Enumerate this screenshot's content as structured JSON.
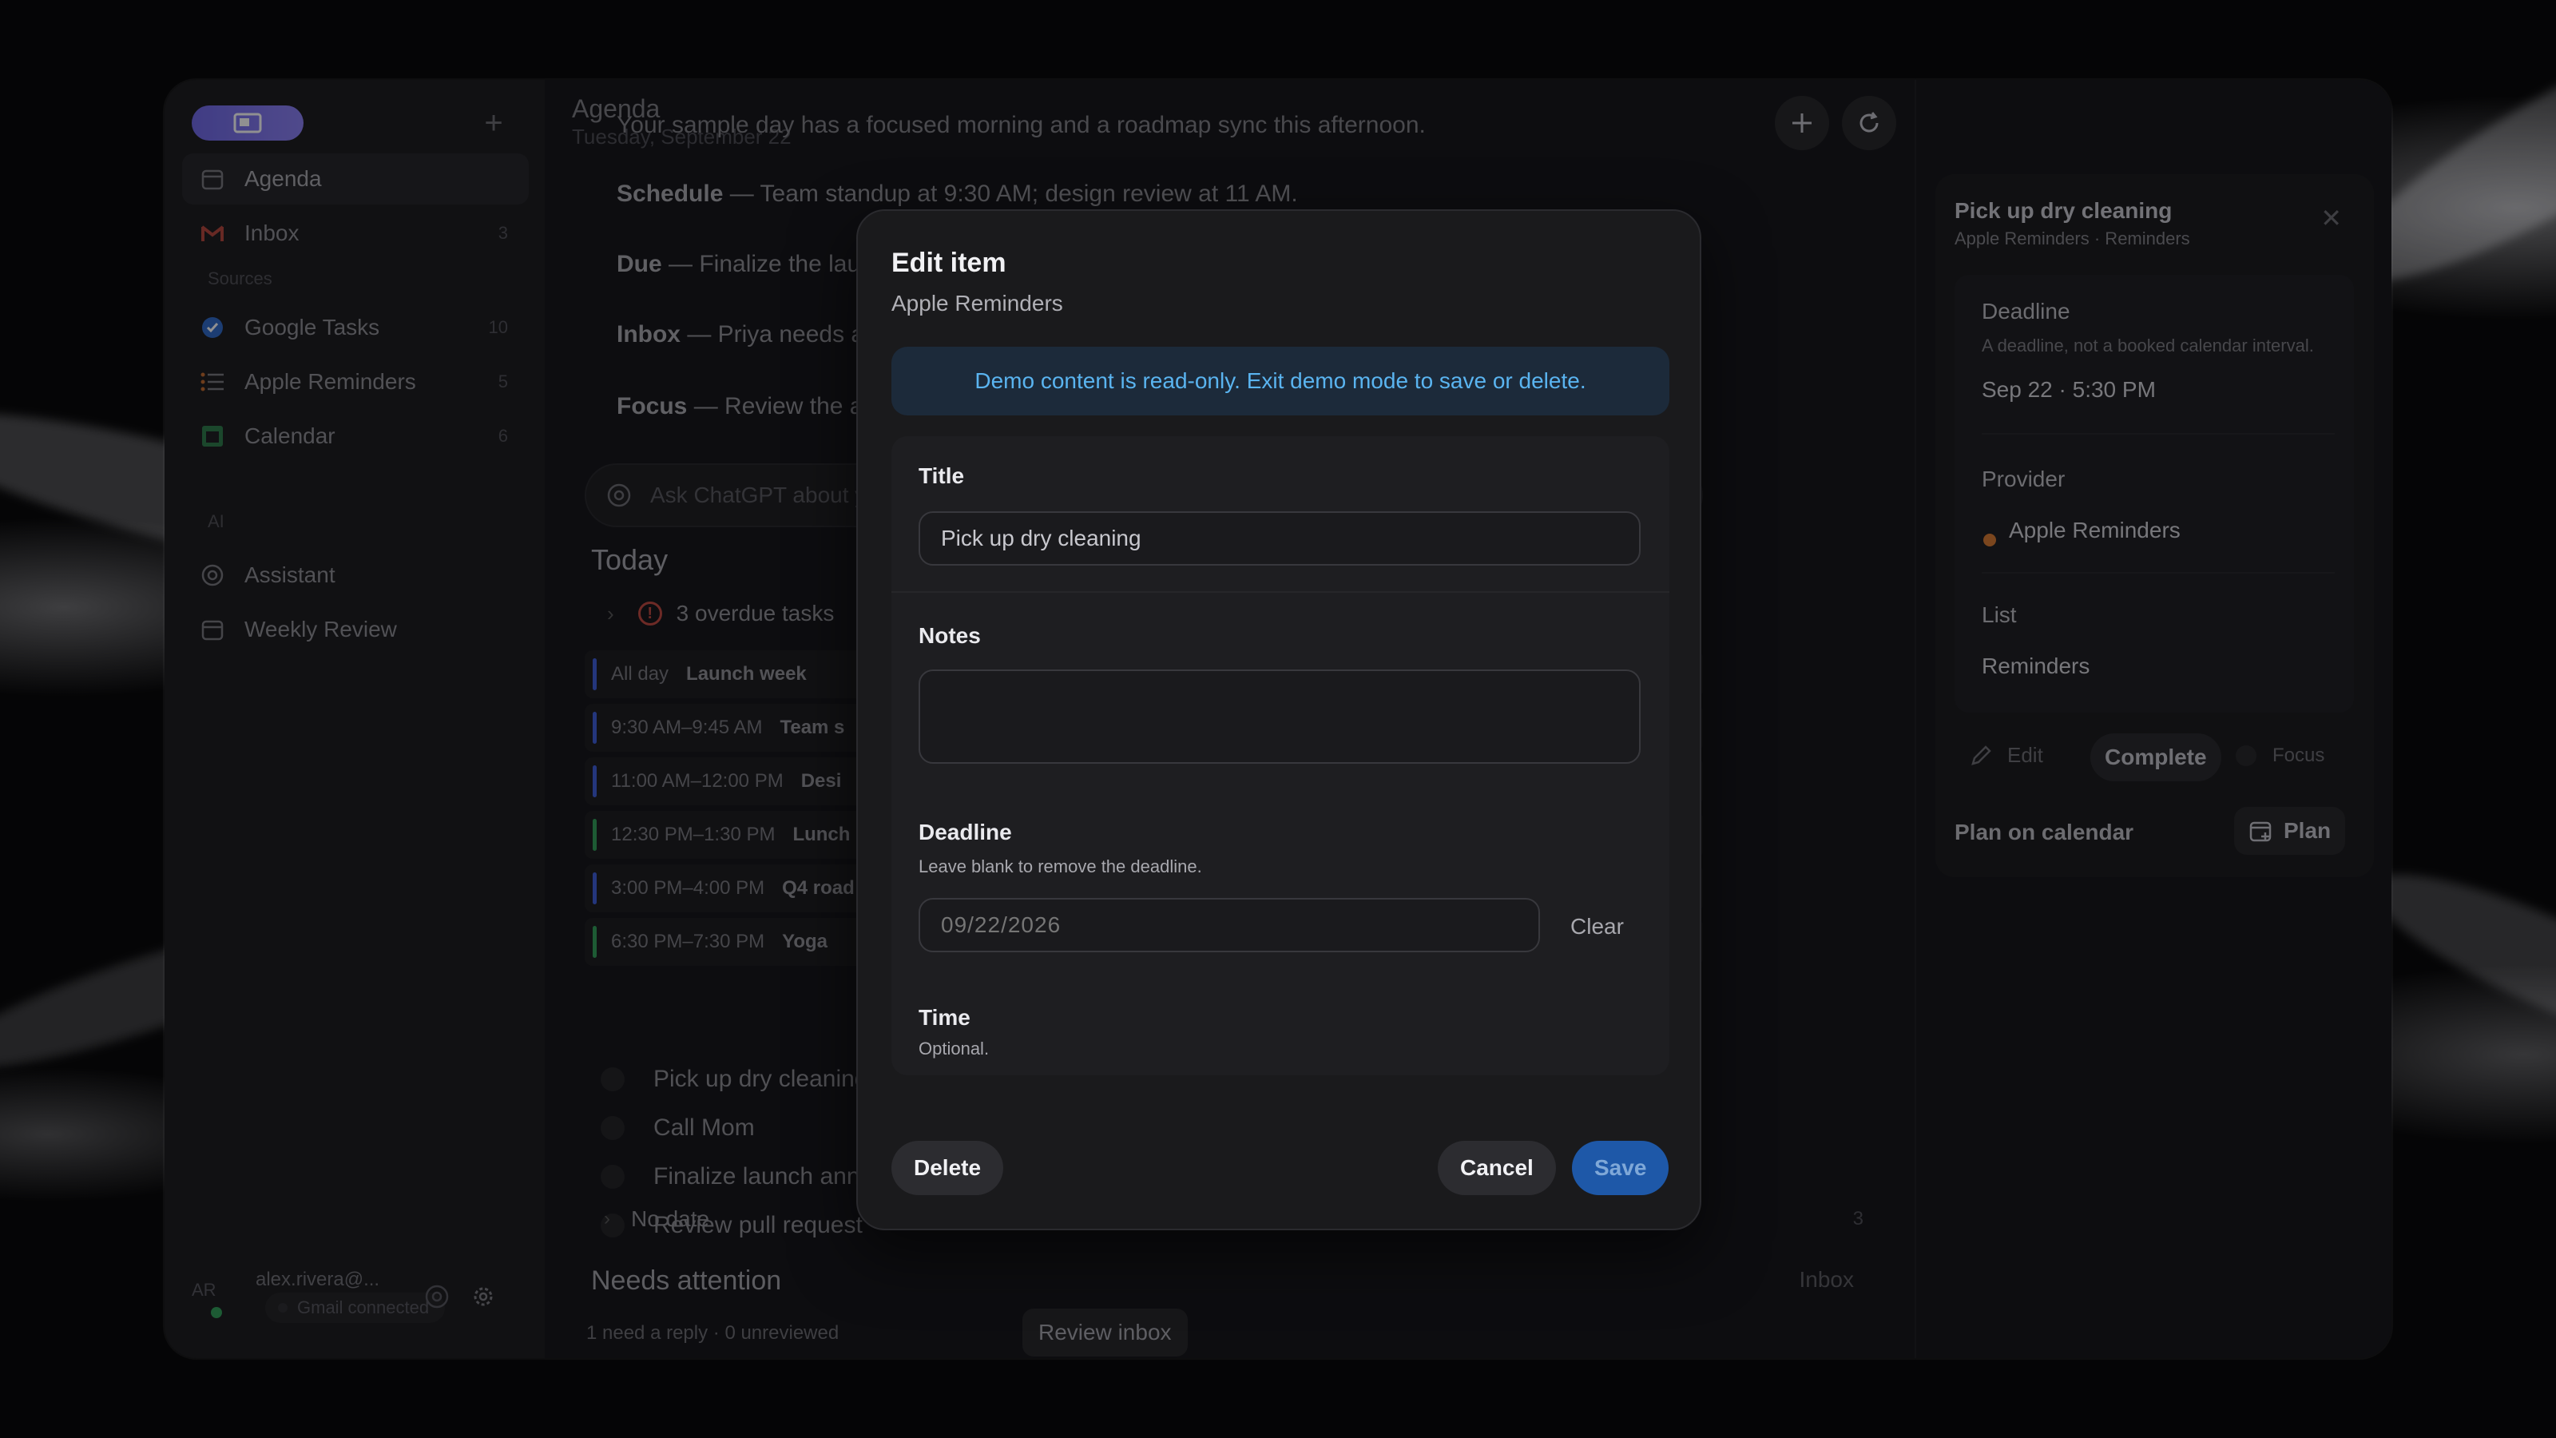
{
  "sidebar": {
    "items": [
      {
        "label": "Agenda",
        "icon": "calendar-icon"
      },
      {
        "label": "Inbox",
        "icon": "gmail-icon",
        "count": "3"
      }
    ],
    "sources_heading": "Sources",
    "sources": [
      {
        "label": "Google Tasks",
        "icon": "google-tasks-icon",
        "count": "10"
      },
      {
        "label": "Apple Reminders",
        "icon": "list-icon",
        "count": "5"
      },
      {
        "label": "Calendar",
        "icon": "calendar-grid-icon",
        "count": "6"
      }
    ],
    "ai_heading": "AI",
    "ai_items": [
      {
        "label": "Assistant",
        "icon": "openai-icon"
      },
      {
        "label": "Weekly Review",
        "icon": "calendar-icon"
      }
    ],
    "footer": {
      "avatar_initials": "AR",
      "email": "alex.rivera@...",
      "gmail_status": "Gmail connected"
    }
  },
  "main": {
    "title": "Agenda",
    "date": "Tuesday, September 22",
    "summary": "Your sample day has a focused morning and a roadmap sync this afternoon.",
    "brief": [
      {
        "key": "Schedule",
        "text": " — Team standup at 9:30 AM; design review at 11 AM."
      },
      {
        "key": "Due",
        "text": " — Finalize the lau"
      },
      {
        "key": "Inbox",
        "text": " — Priya needs a"
      },
      {
        "key": "Focus",
        "text": " — Review the a"
      }
    ],
    "ask_placeholder": "Ask ChatGPT about y",
    "today_heading": "Today",
    "overdue_label": "3 overdue tasks",
    "events": [
      {
        "time": "All day",
        "title": "Launch week",
        "color": "#3b5bd9"
      },
      {
        "time": "9:30 AM–9:45 AM",
        "title": "Team s",
        "color": "#3b5bd9"
      },
      {
        "time": "11:00 AM–12:00 PM",
        "title": "Desi",
        "color": "#3b5bd9"
      },
      {
        "time": "12:30 PM–1:30 PM",
        "title": "Lunch",
        "color": "#2f9e57"
      },
      {
        "time": "3:00 PM–4:00 PM",
        "title": "Q4 road",
        "color": "#3b5bd9"
      },
      {
        "time": "6:30 PM–7:30 PM",
        "title": "Yoga",
        "color": "#2f9e57"
      }
    ],
    "tasks": [
      "Pick up dry cleaning",
      "Call Mom",
      "Finalize launch anno",
      "Review pull request"
    ],
    "no_date_label": "No date",
    "no_date_count": "3",
    "needs_attention": {
      "heading": "Needs attention",
      "link": "Inbox",
      "subtitle": "1 need a reply · 0 unreviewed",
      "button": "Review inbox"
    }
  },
  "detail": {
    "title": "Pick up dry cleaning",
    "subtitle": "Apple Reminders · Reminders",
    "deadline_label": "Deadline",
    "deadline_desc": "A deadline, not a booked calendar interval.",
    "deadline_value": "Sep 22 · 5:30 PM",
    "provider_label": "Provider",
    "provider_value": "Apple Reminders",
    "provider_color": "#d9792e",
    "list_label": "List",
    "list_value": "Reminders",
    "edit_label": "Edit",
    "complete_label": "Complete",
    "focus_label": "Focus",
    "plan_label": "Plan on calendar",
    "plan_button": "Plan"
  },
  "modal": {
    "title": "Edit item",
    "subtitle": "Apple Reminders",
    "banner": "Demo content is read-only. Exit demo mode to save or delete.",
    "title_label": "Title",
    "title_value": "Pick up dry cleaning",
    "notes_label": "Notes",
    "notes_value": "",
    "deadline_label": "Deadline",
    "deadline_help": "Leave blank to remove the deadline.",
    "deadline_value": "09/22/2026",
    "clear_label": "Clear",
    "time_label": "Time",
    "time_help": "Optional.",
    "delete_label": "Delete",
    "cancel_label": "Cancel",
    "save_label": "Save"
  },
  "colors": {
    "accent": "#7a72ee",
    "banner_text": "#5ab4f0",
    "save_bg": "#1e58a8",
    "danger": "#c0453c"
  }
}
